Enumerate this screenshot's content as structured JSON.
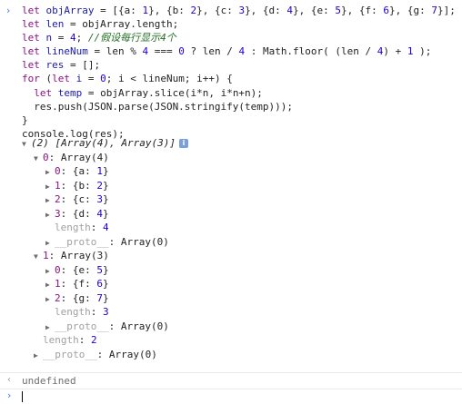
{
  "input_code": {
    "lines": [
      [
        {
          "t": "kw",
          "v": "let "
        },
        {
          "t": "var",
          "v": "objArray"
        },
        {
          "t": "op",
          "v": " = [{a: "
        },
        {
          "t": "num",
          "v": "1"
        },
        {
          "t": "op",
          "v": "}, {b: "
        },
        {
          "t": "num",
          "v": "2"
        },
        {
          "t": "op",
          "v": "}, {c: "
        },
        {
          "t": "num",
          "v": "3"
        },
        {
          "t": "op",
          "v": "}, {d: "
        },
        {
          "t": "num",
          "v": "4"
        },
        {
          "t": "op",
          "v": "}, {e: "
        },
        {
          "t": "num",
          "v": "5"
        },
        {
          "t": "op",
          "v": "}, {f: "
        },
        {
          "t": "num",
          "v": "6"
        },
        {
          "t": "op",
          "v": "}, {g: "
        },
        {
          "t": "num",
          "v": "7"
        },
        {
          "t": "op",
          "v": "}];"
        }
      ],
      [
        {
          "t": "kw",
          "v": "let "
        },
        {
          "t": "var",
          "v": "len"
        },
        {
          "t": "op",
          "v": " = objArray.length;"
        }
      ],
      [
        {
          "t": "kw",
          "v": "let "
        },
        {
          "t": "var",
          "v": "n"
        },
        {
          "t": "op",
          "v": " = "
        },
        {
          "t": "num",
          "v": "4"
        },
        {
          "t": "op",
          "v": "; "
        },
        {
          "t": "comment",
          "v": "//假设每行显示4个"
        }
      ],
      [
        {
          "t": "kw",
          "v": "let "
        },
        {
          "t": "var",
          "v": "lineNum"
        },
        {
          "t": "op",
          "v": " = len % "
        },
        {
          "t": "num",
          "v": "4"
        },
        {
          "t": "op",
          "v": " === "
        },
        {
          "t": "num",
          "v": "0"
        },
        {
          "t": "op",
          "v": " ? len / "
        },
        {
          "t": "num",
          "v": "4"
        },
        {
          "t": "op",
          "v": " : Math.floor( (len / "
        },
        {
          "t": "num",
          "v": "4"
        },
        {
          "t": "op",
          "v": ") + "
        },
        {
          "t": "num",
          "v": "1"
        },
        {
          "t": "op",
          "v": " );"
        }
      ],
      [
        {
          "t": "kw",
          "v": "let "
        },
        {
          "t": "var",
          "v": "res"
        },
        {
          "t": "op",
          "v": " = [];"
        }
      ],
      [
        {
          "t": "kw",
          "v": "for "
        },
        {
          "t": "op",
          "v": "("
        },
        {
          "t": "kw",
          "v": "let "
        },
        {
          "t": "var",
          "v": "i"
        },
        {
          "t": "op",
          "v": " = "
        },
        {
          "t": "num",
          "v": "0"
        },
        {
          "t": "op",
          "v": "; i < lineNum; i++) {"
        }
      ],
      [
        {
          "t": "op",
          "v": "  "
        },
        {
          "t": "kw",
          "v": "let "
        },
        {
          "t": "var",
          "v": "temp"
        },
        {
          "t": "op",
          "v": " = objArray.slice(i*n, i*n+n);"
        }
      ],
      [
        {
          "t": "op",
          "v": "  res.push(JSON.parse(JSON.stringify(temp)));"
        }
      ],
      [
        {
          "t": "op",
          "v": "}"
        }
      ],
      [
        {
          "t": "op",
          "v": "console.log(res);"
        }
      ]
    ]
  },
  "output_tree": [
    {
      "indent": 0,
      "tri": "down",
      "parts": [
        {
          "c": "italic",
          "v": "(2) [Array(4), Array(3)]"
        }
      ],
      "info": "i"
    },
    {
      "indent": 1,
      "tri": "down",
      "parts": [
        {
          "c": "key",
          "v": "0"
        },
        {
          "c": "",
          "v": ": Array(4)"
        }
      ]
    },
    {
      "indent": 2,
      "tri": "right",
      "parts": [
        {
          "c": "key",
          "v": "0"
        },
        {
          "c": "",
          "v": ": {a: "
        },
        {
          "c": "val-num",
          "v": "1"
        },
        {
          "c": "",
          "v": "}"
        }
      ]
    },
    {
      "indent": 2,
      "tri": "right",
      "parts": [
        {
          "c": "key",
          "v": "1"
        },
        {
          "c": "",
          "v": ": {b: "
        },
        {
          "c": "val-num",
          "v": "2"
        },
        {
          "c": "",
          "v": "}"
        }
      ]
    },
    {
      "indent": 2,
      "tri": "right",
      "parts": [
        {
          "c": "key",
          "v": "2"
        },
        {
          "c": "",
          "v": ": {c: "
        },
        {
          "c": "val-num",
          "v": "3"
        },
        {
          "c": "",
          "v": "}"
        }
      ]
    },
    {
      "indent": 2,
      "tri": "right",
      "parts": [
        {
          "c": "key",
          "v": "3"
        },
        {
          "c": "",
          "v": ": {d: "
        },
        {
          "c": "val-num",
          "v": "4"
        },
        {
          "c": "",
          "v": "}"
        }
      ]
    },
    {
      "indent": 2,
      "tri": "none",
      "parts": [
        {
          "c": "gray-key",
          "v": "length"
        },
        {
          "c": "",
          "v": ": "
        },
        {
          "c": "val-num",
          "v": "4"
        }
      ]
    },
    {
      "indent": 2,
      "tri": "right",
      "parts": [
        {
          "c": "gray-key",
          "v": "__proto__"
        },
        {
          "c": "",
          "v": ": Array(0)"
        }
      ]
    },
    {
      "indent": 1,
      "tri": "down",
      "parts": [
        {
          "c": "key",
          "v": "1"
        },
        {
          "c": "",
          "v": ": Array(3)"
        }
      ]
    },
    {
      "indent": 2,
      "tri": "right",
      "parts": [
        {
          "c": "key",
          "v": "0"
        },
        {
          "c": "",
          "v": ": {e: "
        },
        {
          "c": "val-num",
          "v": "5"
        },
        {
          "c": "",
          "v": "}"
        }
      ]
    },
    {
      "indent": 2,
      "tri": "right",
      "parts": [
        {
          "c": "key",
          "v": "1"
        },
        {
          "c": "",
          "v": ": {f: "
        },
        {
          "c": "val-num",
          "v": "6"
        },
        {
          "c": "",
          "v": "}"
        }
      ]
    },
    {
      "indent": 2,
      "tri": "right",
      "parts": [
        {
          "c": "key",
          "v": "2"
        },
        {
          "c": "",
          "v": ": {g: "
        },
        {
          "c": "val-num",
          "v": "7"
        },
        {
          "c": "",
          "v": "}"
        }
      ]
    },
    {
      "indent": 2,
      "tri": "none",
      "parts": [
        {
          "c": "gray-key",
          "v": "length"
        },
        {
          "c": "",
          "v": ": "
        },
        {
          "c": "val-num",
          "v": "3"
        }
      ]
    },
    {
      "indent": 2,
      "tri": "right",
      "parts": [
        {
          "c": "gray-key",
          "v": "__proto__"
        },
        {
          "c": "",
          "v": ": Array(0)"
        }
      ]
    },
    {
      "indent": 1,
      "tri": "none",
      "parts": [
        {
          "c": "gray-key",
          "v": "length"
        },
        {
          "c": "",
          "v": ": "
        },
        {
          "c": "val-num",
          "v": "2"
        }
      ]
    },
    {
      "indent": 1,
      "tri": "right",
      "parts": [
        {
          "c": "gray-key",
          "v": "__proto__"
        },
        {
          "c": "",
          "v": ": Array(0)"
        }
      ]
    }
  ],
  "result": {
    "text": "undefined"
  },
  "colors": {
    "prompt": "#367cf1",
    "keyword": "#881280",
    "number": "#1c00cf",
    "comment": "#236e25"
  }
}
